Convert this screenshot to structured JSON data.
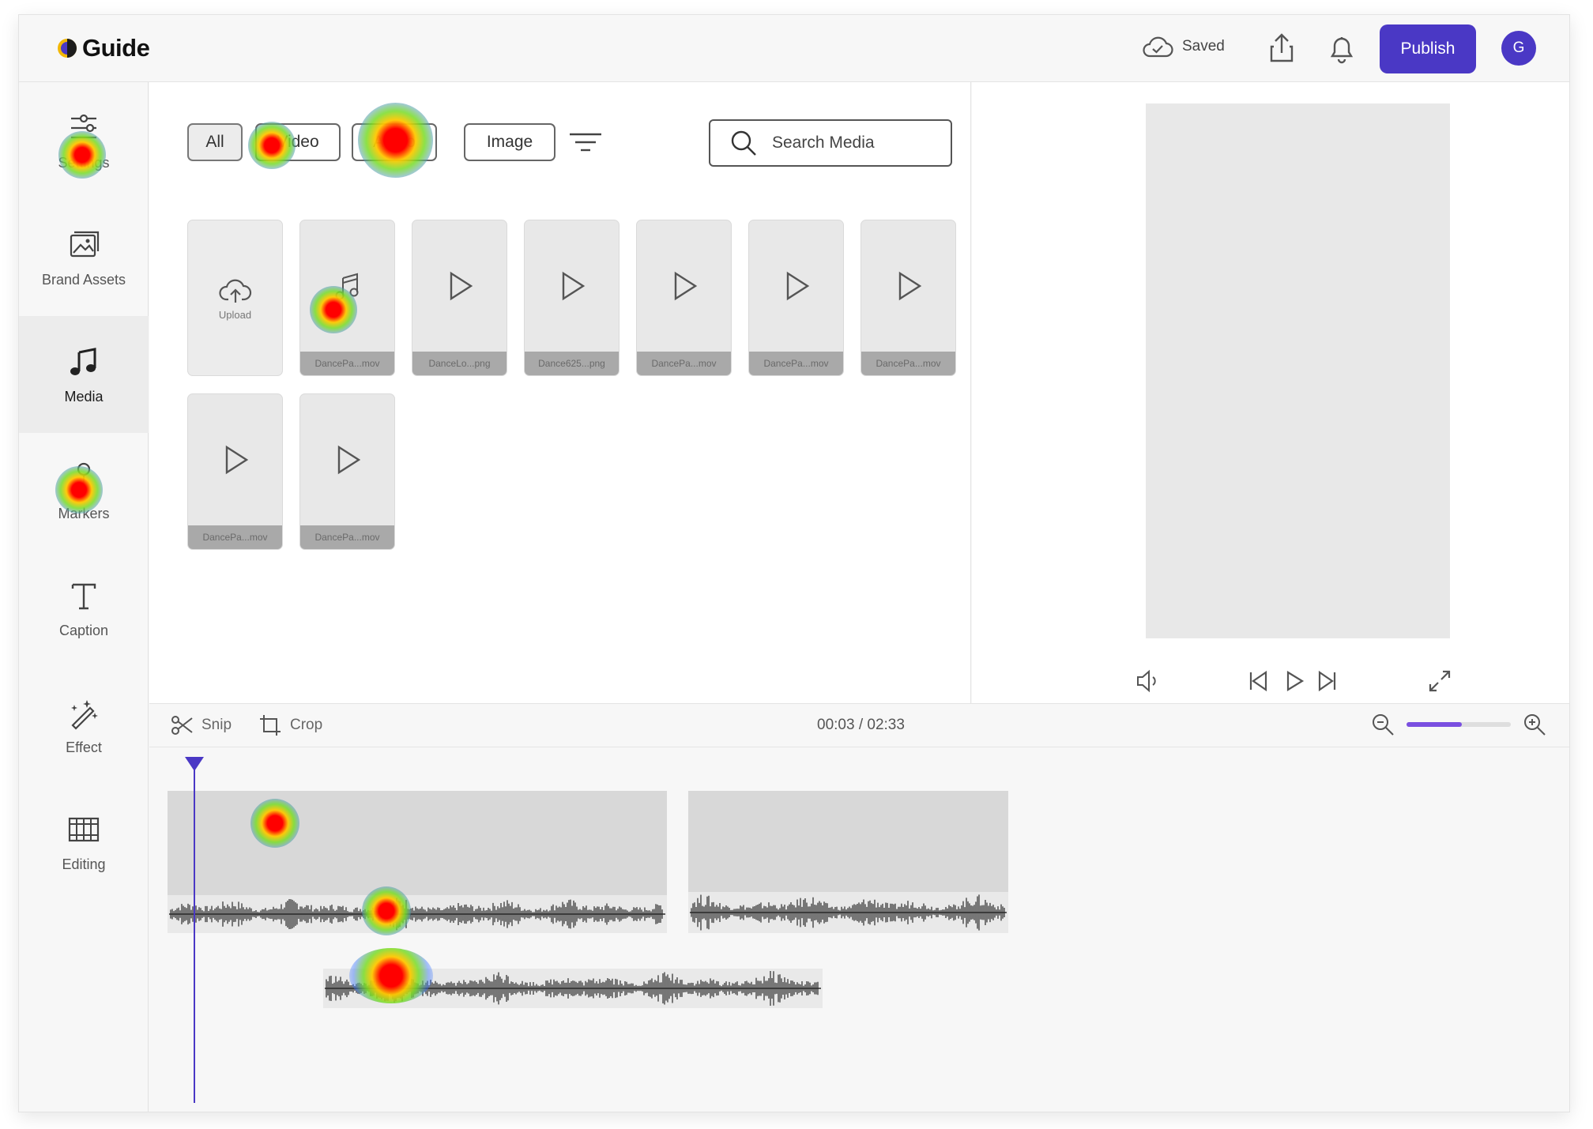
{
  "app": {
    "name": "Guide"
  },
  "header": {
    "saved_label": "Saved",
    "publish_label": "Publish",
    "avatar_initial": "G"
  },
  "sidebar": {
    "items": [
      {
        "label": "Settings",
        "icon": "sliders-icon",
        "active": false
      },
      {
        "label": "Brand Assets",
        "icon": "image-icon",
        "active": false
      },
      {
        "label": "Media",
        "icon": "music-note-icon",
        "active": true
      },
      {
        "label": "Markers",
        "icon": "marker-pin-icon",
        "active": false
      },
      {
        "label": "Caption",
        "icon": "text-icon",
        "active": false
      },
      {
        "label": "Effect",
        "icon": "magic-wand-icon",
        "active": false
      },
      {
        "label": "Editing",
        "icon": "film-strip-icon",
        "active": false
      }
    ]
  },
  "media": {
    "filters": [
      "All",
      "Video",
      "Audio",
      "Image"
    ],
    "active_filter": "All",
    "search_placeholder": "Search Media",
    "upload_label": "Upload",
    "tiles": [
      {
        "label": "DancePa...mov",
        "icon": "music-note-icon"
      },
      {
        "label": "DanceLo...png",
        "icon": "play-icon"
      },
      {
        "label": "Dance625...png",
        "icon": "play-icon"
      },
      {
        "label": "DancePa...mov",
        "icon": "play-icon"
      },
      {
        "label": "DancePa...mov",
        "icon": "play-icon"
      },
      {
        "label": "DancePa...mov",
        "icon": "play-icon"
      },
      {
        "label": "DancePa...mov",
        "icon": "play-icon"
      },
      {
        "label": "DancePa...mov",
        "icon": "play-icon"
      }
    ]
  },
  "timeline": {
    "tools": {
      "snip": "Snip",
      "crop": "Crop"
    },
    "timecode": "00:03 / 02:33",
    "zoom_level": 0.53
  },
  "colors": {
    "accent": "#4a38c5",
    "zoom_fill": "#7a4fe0"
  }
}
